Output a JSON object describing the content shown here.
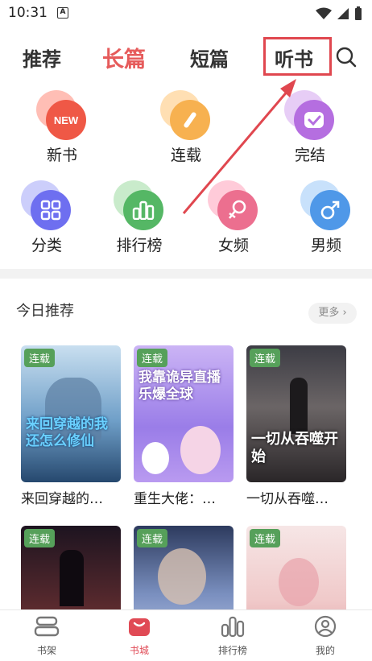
{
  "status": {
    "time": "10:31",
    "notif": "A"
  },
  "tabs": [
    {
      "label": "推荐"
    },
    {
      "label": "长篇"
    },
    {
      "label": "短篇"
    },
    {
      "label": "听书"
    }
  ],
  "categories": [
    {
      "label": "新书",
      "icon": "new-icon",
      "badge_text": "NEW"
    },
    {
      "label": "连载",
      "icon": "pen-icon"
    },
    {
      "label": "完结",
      "icon": "check-icon"
    },
    {
      "label": "分类",
      "icon": "grid-icon"
    },
    {
      "label": "排行榜",
      "icon": "ranking-icon"
    },
    {
      "label": "女频",
      "icon": "female-icon"
    },
    {
      "label": "男频",
      "icon": "male-icon"
    }
  ],
  "today": {
    "title": "今日推荐",
    "more": "更多",
    "books": [
      {
        "title": "来回穿越的…",
        "badge": "连载",
        "cover_text": "来回穿越的我还怎么修仙"
      },
      {
        "title": "重生大佬：…",
        "badge": "连载",
        "cover_text": "我靠诡异直播乐爆全球"
      },
      {
        "title": "一切从吞噬…",
        "badge": "连载",
        "cover_text": "一切从吞噬开始"
      },
      {
        "title": "",
        "badge": "连载",
        "cover_text": ""
      },
      {
        "title": "",
        "badge": "连载",
        "cover_text": ""
      },
      {
        "title": "",
        "badge": "连载",
        "cover_text": ""
      }
    ]
  },
  "nav": [
    {
      "label": "书架"
    },
    {
      "label": "书城"
    },
    {
      "label": "排行榜"
    },
    {
      "label": "我的"
    }
  ],
  "colors": {
    "accent": "#e65b5b",
    "highlight": "#e0474f",
    "badge": "#56a05a"
  }
}
